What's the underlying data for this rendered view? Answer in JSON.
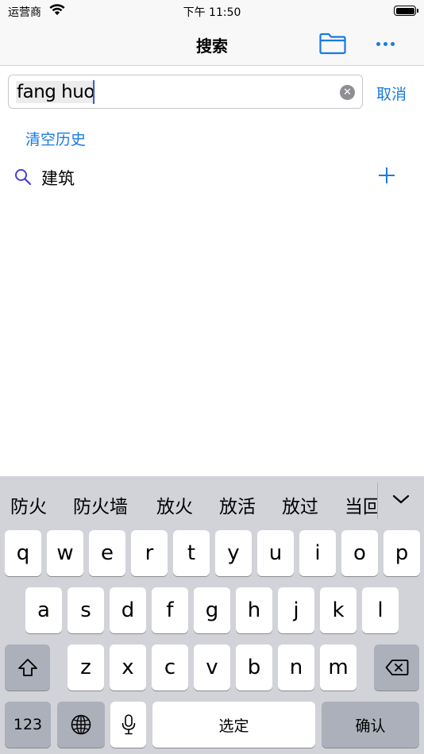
{
  "status_bar": {
    "carrier": "运营商",
    "time": "下午 11:50",
    "wifi_icon": "wifi-icon",
    "battery_icon": "battery-icon"
  },
  "nav": {
    "title": "搜索",
    "folder_icon": "folder-icon",
    "more_icon": "more-icon"
  },
  "search": {
    "value": "fang huo",
    "clear_icon": "clear-icon",
    "cancel_label": "取消"
  },
  "history": {
    "clear_label": "清空历史",
    "items": [
      {
        "text": "建筑",
        "icon": "search-icon",
        "action_icon": "plus-icon"
      }
    ]
  },
  "keyboard": {
    "candidates": [
      "防火",
      "防火墙",
      "放火",
      "放活",
      "放过",
      "当回"
    ],
    "expand_icon": "chevron-down-icon",
    "row1": [
      "q",
      "w",
      "e",
      "r",
      "t",
      "y",
      "u",
      "i",
      "o",
      "p"
    ],
    "row2": [
      "a",
      "s",
      "d",
      "f",
      "g",
      "h",
      "j",
      "k",
      "l"
    ],
    "row3": [
      "z",
      "x",
      "c",
      "v",
      "b",
      "n",
      "m"
    ],
    "shift_icon": "shift-icon",
    "delete_icon": "delete-icon",
    "numbers_label": "123",
    "globe_icon": "globe-icon",
    "mic_icon": "microphone-icon",
    "space_label": "选定",
    "return_label": "确认"
  },
  "colors": {
    "accent": "#1a7ae0",
    "keyboard_bg": "#d1d3d9",
    "key_dark": "#abb0bb"
  }
}
